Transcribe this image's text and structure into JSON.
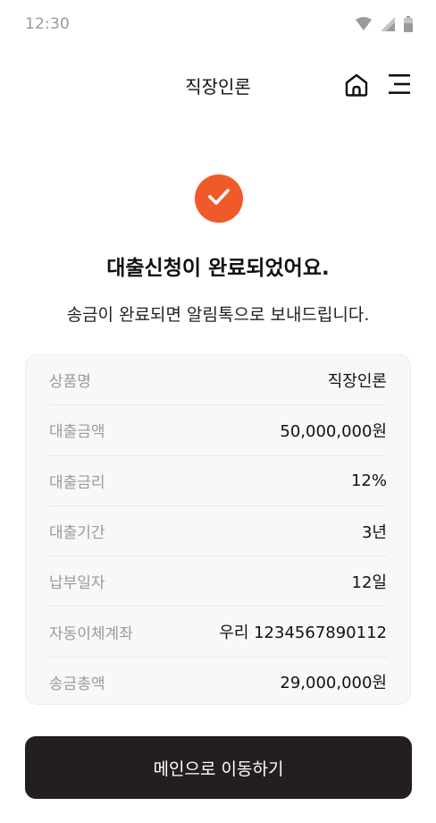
{
  "status_bar": {
    "time": "12:30",
    "icons": [
      "wifi-icon",
      "signal-icon",
      "battery-icon"
    ]
  },
  "header": {
    "title": "직장인론",
    "icons": [
      "home-icon",
      "menu-icon"
    ]
  },
  "result": {
    "title": "대출신청이 완료되었어요.",
    "subtitle": "송금이 완료되면 알림톡으로 보내드립니다.",
    "icon": "check-icon",
    "accent_color": "#f05a2b"
  },
  "summary": [
    {
      "label": "상품명",
      "value": "직장인론"
    },
    {
      "label": "대출금액",
      "value": "50,000,000원"
    },
    {
      "label": "대출금리",
      "value": "12%"
    },
    {
      "label": "대출기간",
      "value": "3년"
    },
    {
      "label": "납부일자",
      "value": "12일"
    },
    {
      "label": "자동이체계좌",
      "value": "우리 1234567890112"
    },
    {
      "label": "송금총액",
      "value": "29,000,000원"
    }
  ],
  "action": {
    "label": "메인으로 이동하기",
    "color": "#231f20"
  }
}
